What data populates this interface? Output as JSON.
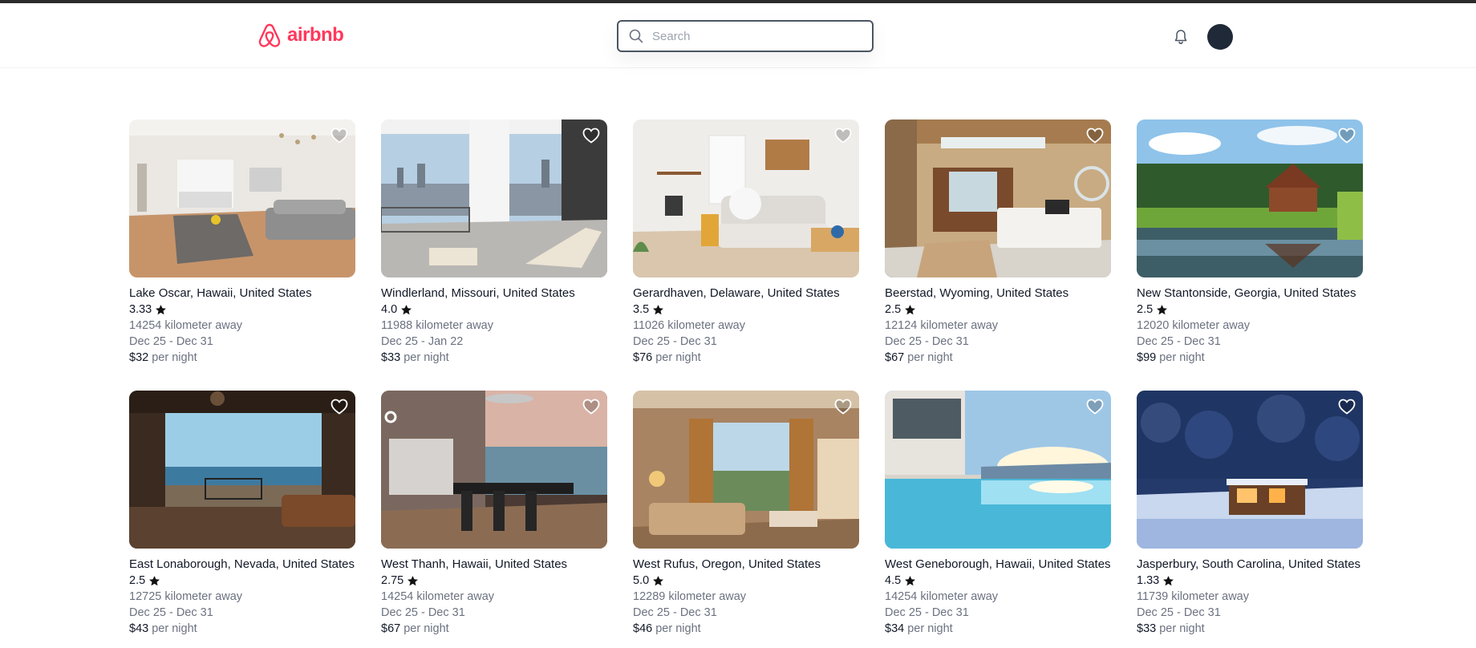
{
  "app": {
    "brand": "airbnb",
    "brand_color": "#ff385c"
  },
  "search": {
    "placeholder": "Search",
    "value": ""
  },
  "header": {
    "bell_icon": "bell-icon",
    "avatar_color": "#1f2937"
  },
  "listings": [
    {
      "location": "Lake Oscar, Hawaii, United States",
      "rating": "3.33",
      "distance": "14254 kilometer away",
      "dates": "Dec 25 - Dec 31",
      "price": "$32",
      "per_night": "per night",
      "image": "apartment-living-room"
    },
    {
      "location": "Windlerland, Missouri, United States",
      "rating": "4.0",
      "distance": "11988 kilometer away",
      "dates": "Dec 25 - Jan 22",
      "price": "$33",
      "per_night": "per night",
      "image": "city-view-balcony"
    },
    {
      "location": "Gerardhaven, Delaware, United States",
      "rating": "3.5",
      "distance": "11026 kilometer away",
      "dates": "Dec 25 - Dec 31",
      "price": "$76",
      "per_night": "per night",
      "image": "white-sofa-room"
    },
    {
      "location": "Beerstad, Wyoming, United States",
      "rating": "2.5",
      "distance": "12124 kilometer away",
      "dates": "Dec 25 - Dec 31",
      "price": "$67",
      "per_night": "per night",
      "image": "wooden-bedroom"
    },
    {
      "location": "New Stantonside, Georgia, United States",
      "rating": "2.5",
      "distance": "12020 kilometer away",
      "dates": "Dec 25 - Dec 31",
      "price": "$99",
      "per_night": "per night",
      "image": "lake-cabin"
    },
    {
      "location": "East Lonaborough, Nevada, United States",
      "rating": "2.5",
      "distance": "12725 kilometer away",
      "dates": "Dec 25 - Dec 31",
      "price": "$43",
      "per_night": "per night",
      "image": "ocean-view-deck"
    },
    {
      "location": "West Thanh, Hawaii, United States",
      "rating": "2.75",
      "distance": "14254 kilometer away",
      "dates": "Dec 25 - Dec 31",
      "price": "$67",
      "per_night": "per night",
      "image": "sea-dining-room"
    },
    {
      "location": "West Rufus, Oregon, United States",
      "rating": "5.0",
      "distance": "12289 kilometer away",
      "dates": "Dec 25 - Dec 31",
      "price": "$46",
      "per_night": "per night",
      "image": "hotel-room-balcony"
    },
    {
      "location": "West Geneborough, Hawaii, United States",
      "rating": "4.5",
      "distance": "14254 kilometer away",
      "dates": "Dec 25 - Dec 31",
      "price": "$34",
      "per_night": "per night",
      "image": "infinity-pool"
    },
    {
      "location": "Jasperbury, South Carolina, United States",
      "rating": "1.33",
      "distance": "11739 kilometer away",
      "dates": "Dec 25 - Dec 31",
      "price": "$33",
      "per_night": "per night",
      "image": "snow-cabin"
    }
  ]
}
